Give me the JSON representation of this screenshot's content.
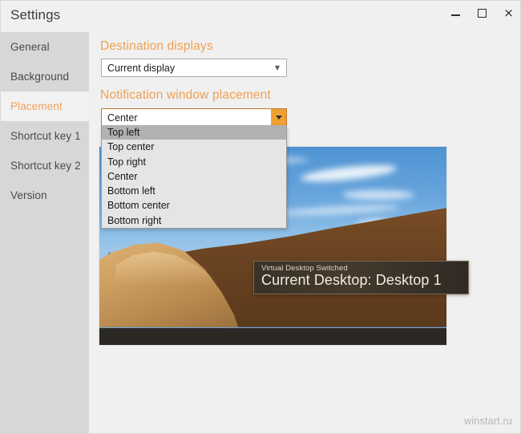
{
  "window": {
    "title": "Settings",
    "controls": {
      "minimize": "minimize",
      "maximize": "maximize",
      "close": "×"
    }
  },
  "sidebar": {
    "items": [
      {
        "label": "General",
        "selected": false
      },
      {
        "label": "Background",
        "selected": false
      },
      {
        "label": "Placement",
        "selected": true
      },
      {
        "label": "Shortcut key 1",
        "selected": false
      },
      {
        "label": "Shortcut key 2",
        "selected": false
      },
      {
        "label": "Version",
        "selected": false
      }
    ]
  },
  "main": {
    "destination": {
      "heading": "Destination displays",
      "selected": "Current display"
    },
    "placement": {
      "heading": "Notification window placement",
      "selected": "Center",
      "options": [
        "Top left",
        "Top center",
        "Top right",
        "Center",
        "Bottom left",
        "Bottom center",
        "Bottom right"
      ],
      "highlighted_option": "Top left"
    },
    "toast": {
      "subtitle": "Virtual Desktop Switched",
      "title": "Current Desktop: Desktop 1"
    }
  },
  "watermark": "winstart.ru",
  "colors": {
    "accent_orange": "#f0a050",
    "sidebar_bg": "#d7d7da",
    "content_bg": "#f0f0f0",
    "selected_item_bg": "#f2f2f3",
    "dropdown_bg": "#e5e5e5",
    "dropdown_highlight": "#b1b1b1",
    "toast_bg": "#3b3227"
  }
}
